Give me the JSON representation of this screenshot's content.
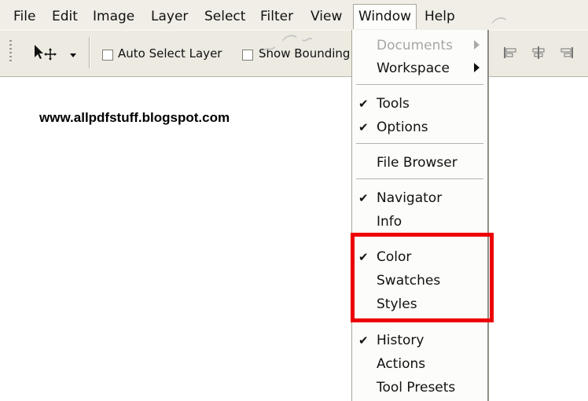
{
  "menubar": {
    "items": [
      "File",
      "Edit",
      "Image",
      "Layer",
      "Select",
      "Filter",
      "View",
      "Window",
      "Help"
    ],
    "open_item": "Window"
  },
  "options_bar": {
    "tool": "move-tool",
    "auto_select_label": "Auto Select Layer",
    "show_bounding_label": "Show Bounding",
    "auto_select_checked": false,
    "show_bounding_checked": false
  },
  "page": {
    "url_text": "www.allpdfstuff.blogspot.com"
  },
  "window_menu": {
    "items": [
      {
        "label": "Documents",
        "checked": false,
        "submenu": true,
        "disabled": true
      },
      {
        "label": "Workspace",
        "checked": false,
        "submenu": true,
        "disabled": false
      },
      {
        "label": "Tools",
        "checked": true,
        "submenu": false,
        "disabled": false
      },
      {
        "label": "Options",
        "checked": true,
        "submenu": false,
        "disabled": false
      },
      {
        "label": "File Browser",
        "checked": false,
        "submenu": false,
        "disabled": false
      },
      {
        "label": "Navigator",
        "checked": true,
        "submenu": false,
        "disabled": false
      },
      {
        "label": "Info",
        "checked": false,
        "submenu": false,
        "disabled": false
      },
      {
        "label": "Color",
        "checked": true,
        "submenu": false,
        "disabled": false
      },
      {
        "label": "Swatches",
        "checked": false,
        "submenu": false,
        "disabled": false
      },
      {
        "label": "Styles",
        "checked": false,
        "submenu": false,
        "disabled": false
      },
      {
        "label": "History",
        "checked": true,
        "submenu": false,
        "disabled": false
      },
      {
        "label": "Actions",
        "checked": false,
        "submenu": false,
        "disabled": false
      },
      {
        "label": "Tool Presets",
        "checked": false,
        "submenu": false,
        "disabled": false
      }
    ]
  },
  "annotation": {
    "highlight_color": "#ee0000",
    "highlighted_items": [
      "Color",
      "Swatches",
      "Styles"
    ]
  },
  "colors": {
    "menubar_bg": "#f0eee6",
    "menu_bg": "#fcfcfa",
    "disabled_text": "#a6a6a6"
  }
}
